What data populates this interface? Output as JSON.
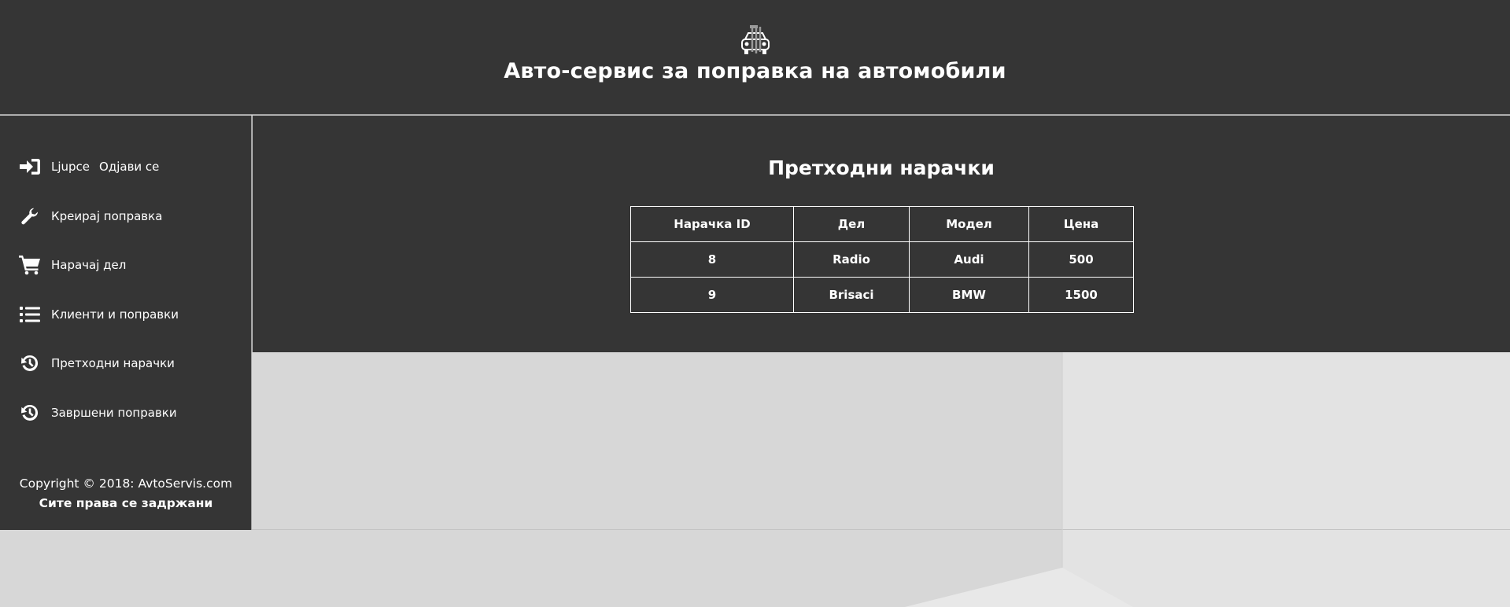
{
  "header": {
    "title": "Авто-сервис за поправка на автомобили",
    "logo_icon": "car-repair-icon"
  },
  "sidebar": {
    "user": {
      "name": "Ljupce",
      "logout_label": "Одјави се",
      "icon": "sign-in-icon"
    },
    "items": [
      {
        "label": "Креирај поправка",
        "icon": "wrench-icon"
      },
      {
        "label": "Нарачај дел",
        "icon": "shopping-cart-icon"
      },
      {
        "label": "Клиенти и поправки",
        "icon": "list-icon"
      },
      {
        "label": "Претходни нарачки",
        "icon": "history-icon"
      },
      {
        "label": "Завршени поправки",
        "icon": "history-icon"
      }
    ],
    "footer": {
      "copyright": "Copyright © 2018: AvtoServis.com",
      "rights": "Сите права се задржани"
    }
  },
  "main": {
    "title": "Претходни нарачки",
    "table": {
      "headers": [
        "Нарачка ID",
        "Дел",
        "Модел",
        "Цена"
      ],
      "rows": [
        [
          "8",
          "Radio",
          "Audi",
          "500"
        ],
        [
          "9",
          "Brisaci",
          "BMW",
          "1500"
        ]
      ]
    }
  },
  "colors": {
    "panel": "#353535",
    "text": "#ffffff",
    "background": "#d7d7d7"
  }
}
